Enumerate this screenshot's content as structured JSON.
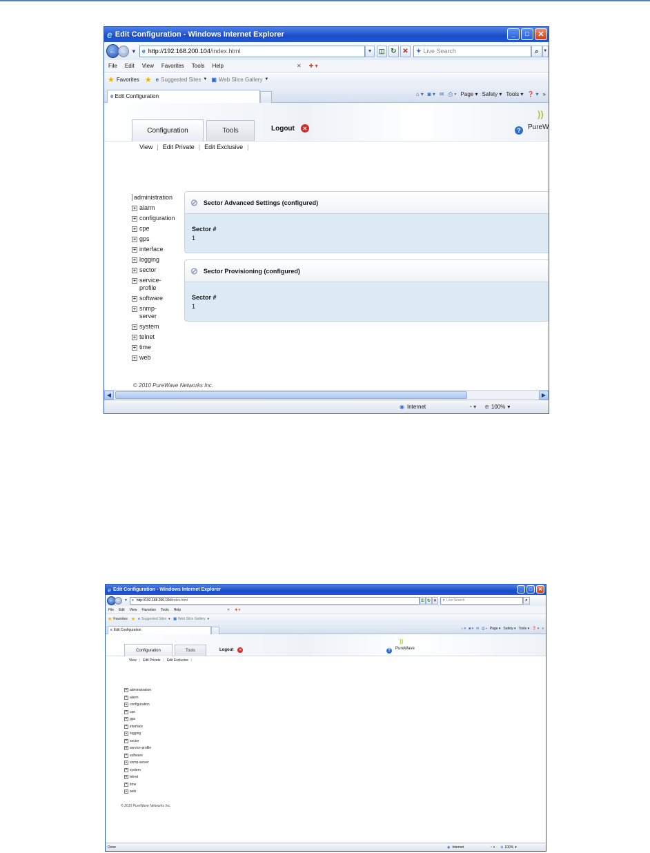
{
  "browser": {
    "window_title": "Edit Configuration - Windows Internet Explorer",
    "address_scheme_host": "http://192.168.200.104",
    "address_path": "/index.html",
    "search_placeholder": "Live Search",
    "menu": [
      "File",
      "Edit",
      "View",
      "Favorites",
      "Tools",
      "Help"
    ],
    "favorites_label": "Favorites",
    "suggested_sites": "Suggested Sites",
    "web_slice_gallery": "Web Slice Gallery",
    "tab_title": "Edit Configuration",
    "commands": {
      "page": "Page",
      "safety": "Safety",
      "tools": "Tools"
    },
    "status_zone": "Internet",
    "zoom": "100%",
    "status_done": "Done"
  },
  "app": {
    "tabs": {
      "configuration": "Configuration",
      "tools": "Tools"
    },
    "logout": "Logout",
    "logo_text": "PureW",
    "logo_text_full": "PureWave",
    "subnav": {
      "view": "View",
      "edit_private": "Edit Private",
      "edit_exclusive": "Edit Exclusive"
    },
    "copyright": "© 2010 PureWave Networks Inc."
  },
  "shot1": {
    "tree": [
      {
        "label": "administration",
        "plus": false
      },
      {
        "label": "alarm",
        "plus": true
      },
      {
        "label": "configuration",
        "plus": true
      },
      {
        "label": "cpe",
        "plus": true
      },
      {
        "label": "gps",
        "plus": true
      },
      {
        "label": "interface",
        "plus": true
      },
      {
        "label": "logging",
        "plus": true
      },
      {
        "label": "sector",
        "plus": true
      },
      {
        "label": "service-profile",
        "plus": true,
        "lines": [
          "service-",
          "profile"
        ]
      },
      {
        "label": "software",
        "plus": true
      },
      {
        "label": "snmp-server",
        "plus": true,
        "lines": [
          "snmp-",
          "server"
        ]
      },
      {
        "label": "system",
        "plus": true
      },
      {
        "label": "telnet",
        "plus": true
      },
      {
        "label": "time",
        "plus": true
      },
      {
        "label": "web",
        "plus": true
      }
    ],
    "panels": [
      {
        "title": "Sector Advanced Settings (configured)",
        "field": "Sector #",
        "value": "1"
      },
      {
        "title": "Sector Provisioning (configured)",
        "field": "Sector #",
        "value": "1"
      }
    ]
  },
  "shot2": {
    "tree": [
      "administration",
      "alarm",
      "configuration",
      "cpe",
      "gps",
      "interface",
      "logging",
      "sector",
      "service-profile",
      "software",
      "snmp-server",
      "system",
      "telnet",
      "time",
      "web"
    ]
  }
}
